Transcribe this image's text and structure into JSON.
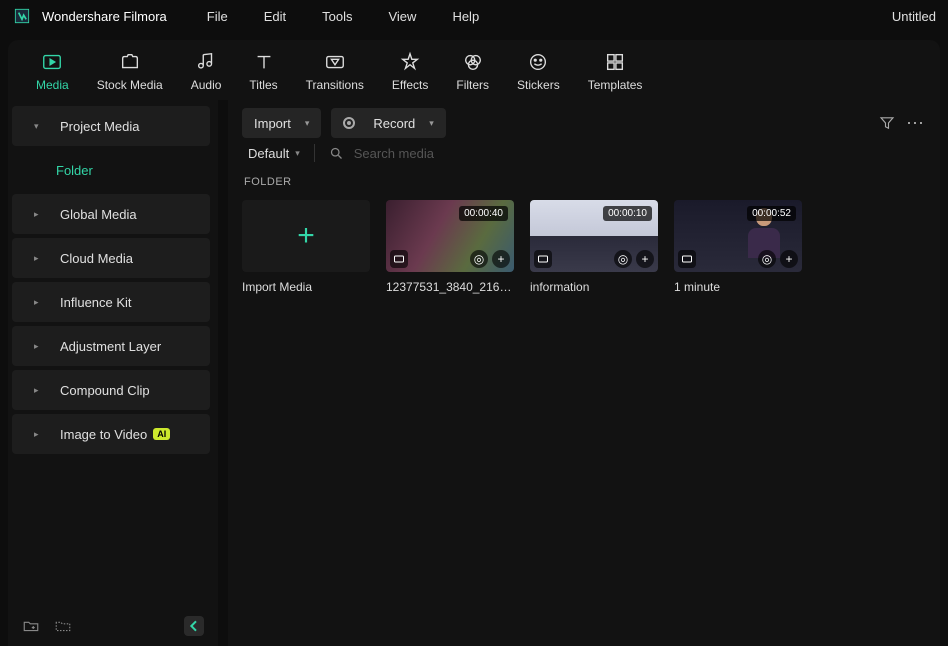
{
  "app": {
    "title": "Wondershare Filmora",
    "document": "Untitled"
  },
  "menu": {
    "items": [
      "File",
      "Edit",
      "Tools",
      "View",
      "Help"
    ]
  },
  "tabs": {
    "items": [
      "Media",
      "Stock Media",
      "Audio",
      "Titles",
      "Transitions",
      "Effects",
      "Filters",
      "Stickers",
      "Templates"
    ],
    "active": "Media"
  },
  "sidebar": {
    "items": [
      {
        "label": "Project Media",
        "expanded": true,
        "children": [
          {
            "label": "Folder",
            "active": true
          }
        ]
      },
      {
        "label": "Global Media"
      },
      {
        "label": "Cloud Media"
      },
      {
        "label": "Influence Kit"
      },
      {
        "label": "Adjustment Layer"
      },
      {
        "label": "Compound Clip"
      },
      {
        "label": "Image to Video",
        "ai": true
      }
    ]
  },
  "toolbar": {
    "import": "Import",
    "record": "Record"
  },
  "search": {
    "sort": "Default",
    "placeholder": "Search media"
  },
  "section": {
    "label": "FOLDER"
  },
  "media": {
    "import_tile": "Import Media",
    "items": [
      {
        "name": "12377531_3840_2160_2...",
        "duration": "00:00:40"
      },
      {
        "name": "information",
        "duration": "00:00:10"
      },
      {
        "name": "1 minute",
        "duration": "00:00:52"
      }
    ]
  },
  "ai_badge": "AI"
}
